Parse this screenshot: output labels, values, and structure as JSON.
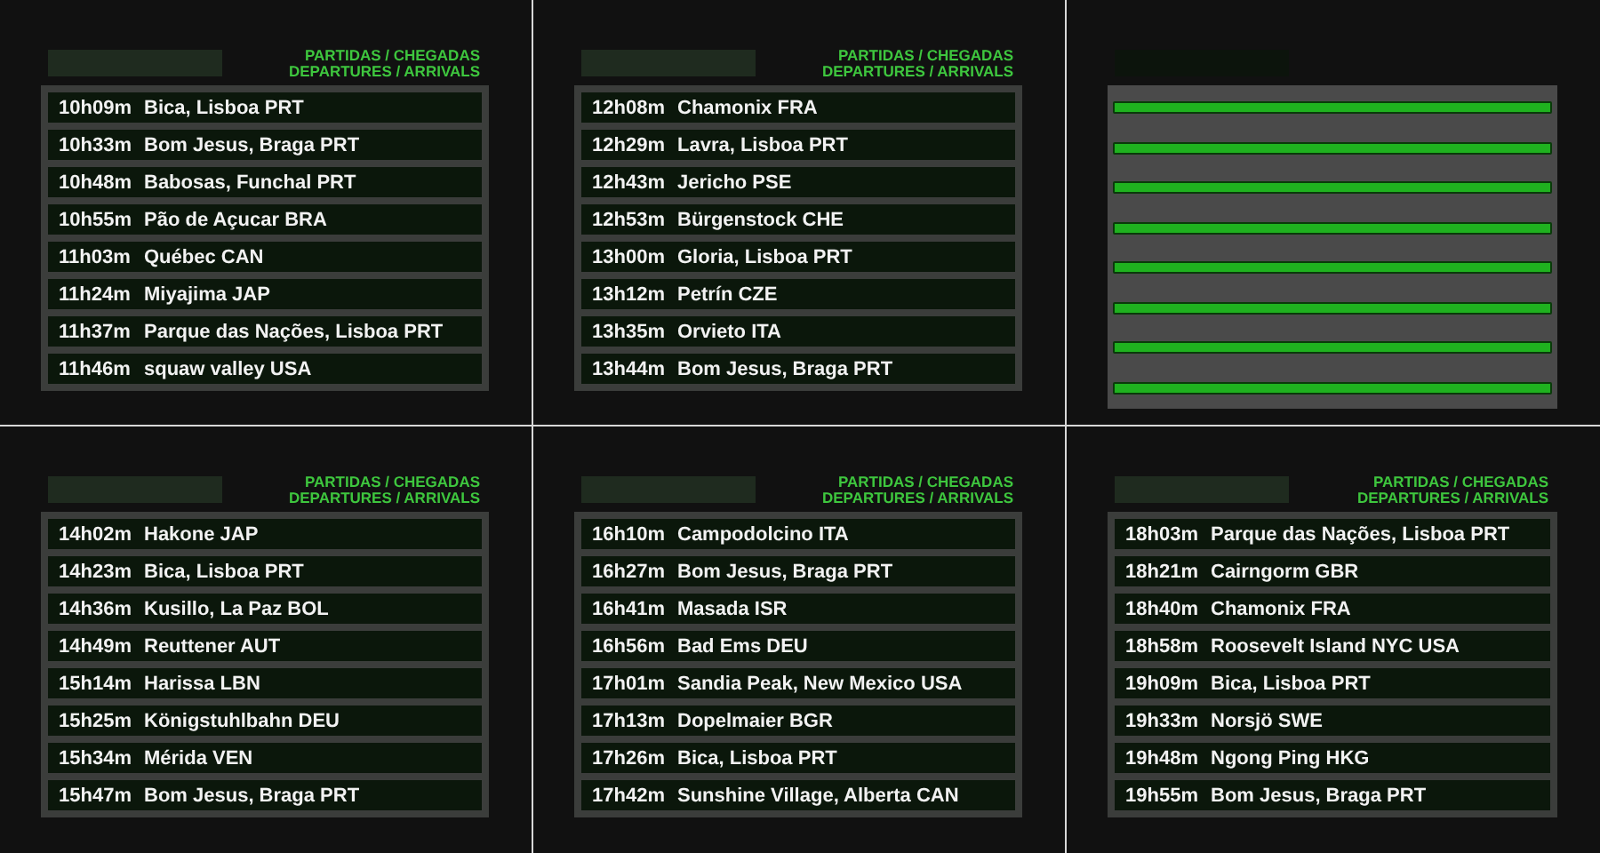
{
  "panels": [
    {
      "kind": "board",
      "heading": [
        "PARTIDAS / CHEGADAS",
        "DEPARTURES / ARRIVALS"
      ],
      "rows": [
        {
          "time": "10h09m",
          "place": "Bica, Lisboa PRT"
        },
        {
          "time": "10h33m",
          "place": "Bom Jesus, Braga PRT"
        },
        {
          "time": "10h48m",
          "place": "Babosas, Funchal PRT"
        },
        {
          "time": "10h55m",
          "place": "Pão de Açucar BRA"
        },
        {
          "time": "11h03m",
          "place": "Québec CAN"
        },
        {
          "time": "11h24m",
          "place": "Miyajima JAP"
        },
        {
          "time": "11h37m",
          "place": "Parque das Nações, Lisboa PRT"
        },
        {
          "time": "11h46m",
          "place": "squaw valley USA"
        }
      ]
    },
    {
      "kind": "board",
      "heading": [
        "PARTIDAS / CHEGADAS",
        "DEPARTURES / ARRIVALS"
      ],
      "rows": [
        {
          "time": "12h08m",
          "place": "Chamonix FRA"
        },
        {
          "time": "12h29m",
          "place": "Lavra, Lisboa PRT"
        },
        {
          "time": "12h43m",
          "place": "Jericho PSE"
        },
        {
          "time": "12h53m",
          "place": "Bürgenstock CHE"
        },
        {
          "time": "13h00m",
          "place": "Gloria, Lisboa PRT"
        },
        {
          "time": "13h12m",
          "place": "Petrín CZE"
        },
        {
          "time": "13h35m",
          "place": "Orvieto ITA"
        },
        {
          "time": "13h44m",
          "place": "Bom Jesus, Braga PRT"
        }
      ]
    },
    {
      "kind": "blank"
    },
    {
      "kind": "board",
      "heading": [
        "PARTIDAS / CHEGADAS",
        "DEPARTURES / ARRIVALS"
      ],
      "rows": [
        {
          "time": "14h02m",
          "place": "Hakone JAP"
        },
        {
          "time": "14h23m",
          "place": "Bica, Lisboa PRT"
        },
        {
          "time": "14h36m",
          "place": "Kusillo, La Paz BOL"
        },
        {
          "time": "14h49m",
          "place": "Reuttener AUT"
        },
        {
          "time": "15h14m",
          "place": "Harissa LBN"
        },
        {
          "time": "15h25m",
          "place": "Königstuhlbahn DEU"
        },
        {
          "time": "15h34m",
          "place": "Mérida VEN"
        },
        {
          "time": "15h47m",
          "place": "Bom Jesus, Braga PRT"
        }
      ]
    },
    {
      "kind": "board",
      "heading": [
        "PARTIDAS / CHEGADAS",
        "DEPARTURES / ARRIVALS"
      ],
      "rows": [
        {
          "time": "16h10m",
          "place": "Campodolcino ITA"
        },
        {
          "time": "16h27m",
          "place": "Bom Jesus, Braga PRT"
        },
        {
          "time": "16h41m",
          "place": "Masada ISR"
        },
        {
          "time": "16h56m",
          "place": "Bad Ems DEU"
        },
        {
          "time": "17h01m",
          "place": "Sandia Peak, New Mexico USA"
        },
        {
          "time": "17h13m",
          "place": "Dopelmaier BGR"
        },
        {
          "time": "17h26m",
          "place": "Bica, Lisboa PRT"
        },
        {
          "time": "17h42m",
          "place": "Sunshine Village, Alberta CAN"
        }
      ]
    },
    {
      "kind": "board",
      "heading": [
        "PARTIDAS / CHEGADAS",
        "DEPARTURES / ARRIVALS"
      ],
      "rows": [
        {
          "time": "18h03m",
          "place": "Parque das Nações, Lisboa PRT"
        },
        {
          "time": "18h21m",
          "place": "Cairngorm GBR"
        },
        {
          "time": "18h40m",
          "place": "Chamonix FRA"
        },
        {
          "time": "18h58m",
          "place": "Roosevelt Island NYC USA"
        },
        {
          "time": "19h09m",
          "place": "Bica, Lisboa PRT"
        },
        {
          "time": "19h33m",
          "place": "Norsjö SWE"
        },
        {
          "time": "19h48m",
          "place": "Ngong Ping HKG"
        },
        {
          "time": "19h55m",
          "place": "Bom Jesus, Braga PRT"
        }
      ]
    }
  ]
}
